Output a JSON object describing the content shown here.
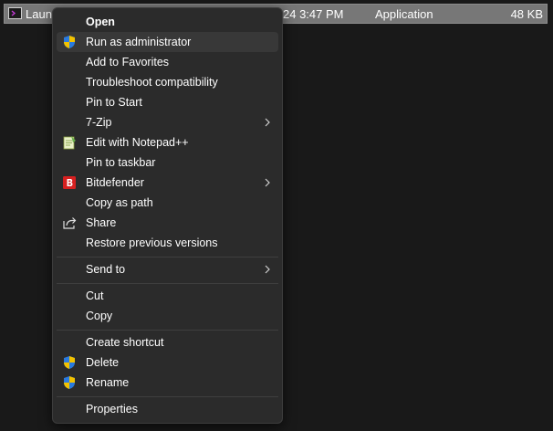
{
  "file": {
    "name": "Launc",
    "date": "24 3:47 PM",
    "type": "Application",
    "size": "48 KB"
  },
  "menu": {
    "open": "Open",
    "run_as_admin": "Run as administrator",
    "add_favorites": "Add to Favorites",
    "troubleshoot": "Troubleshoot compatibility",
    "pin_start": "Pin to Start",
    "seven_zip": "7-Zip",
    "edit_notepad": "Edit with Notepad++",
    "pin_taskbar": "Pin to taskbar",
    "bitdefender": "Bitdefender",
    "copy_path": "Copy as path",
    "share": "Share",
    "restore_versions": "Restore previous versions",
    "send_to": "Send to",
    "cut": "Cut",
    "copy": "Copy",
    "create_shortcut": "Create shortcut",
    "delete": "Delete",
    "rename": "Rename",
    "properties": "Properties"
  },
  "icons": {
    "shield": "uac-shield-icon",
    "notepad": "notepadpp-icon",
    "bitdefender": "bitdefender-icon",
    "share": "share-icon",
    "chevron": "chevron-right-icon"
  },
  "colors": {
    "menu_bg": "#2b2b2b",
    "hover_bg": "#383838",
    "selection_bg": "#777777",
    "bitdefender_red": "#d62020"
  }
}
